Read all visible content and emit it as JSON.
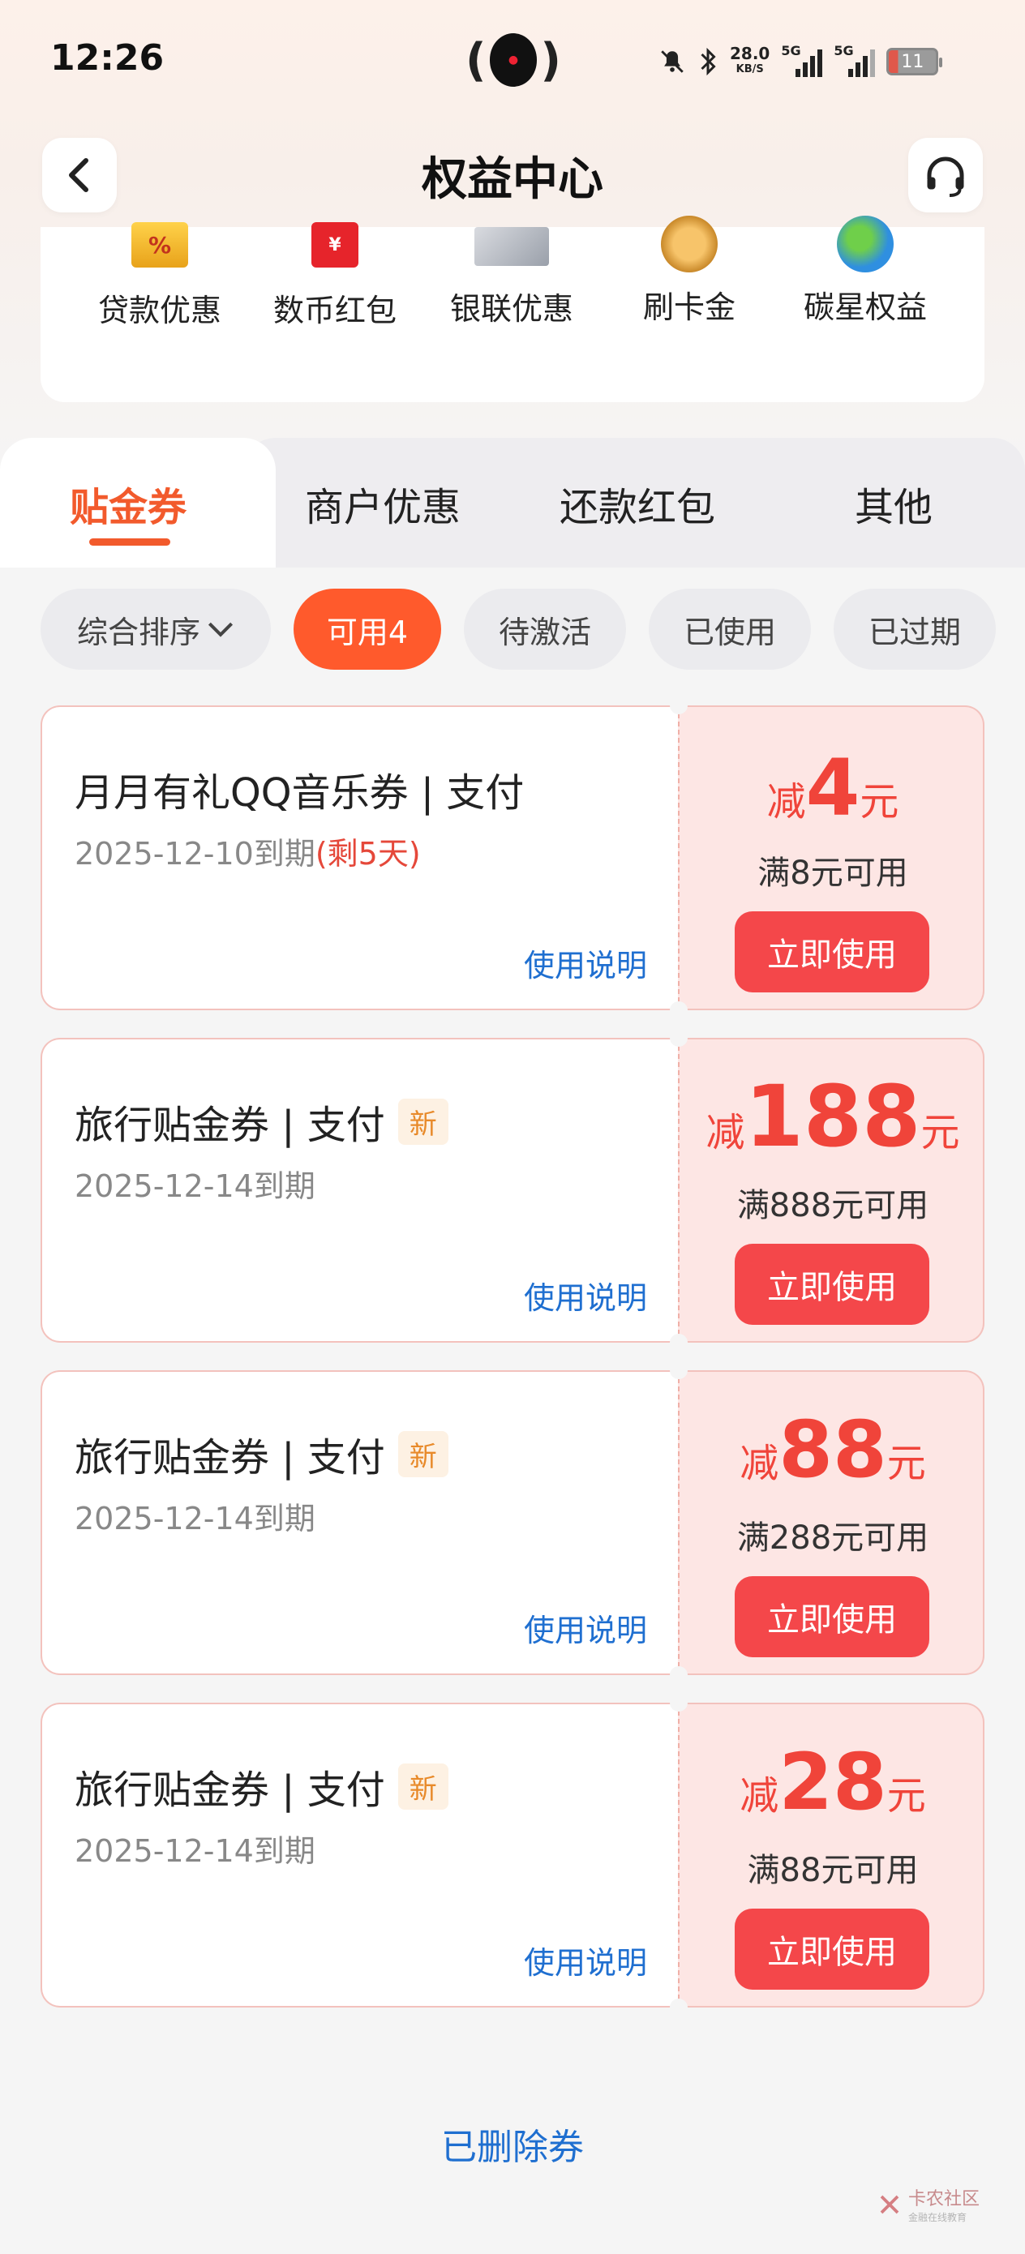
{
  "status_bar": {
    "time": "12:26",
    "speed_value": "28.0",
    "speed_unit": "KB/S",
    "signal1_label": "5G",
    "signal2_label": "5G",
    "battery": "11"
  },
  "header": {
    "title": "权益中心"
  },
  "quick_links": [
    {
      "label": "贷款优惠",
      "icon": "percent-icon"
    },
    {
      "label": "数币红包",
      "icon": "red-packet-icon"
    },
    {
      "label": "银联优惠",
      "icon": "unionpay-card-icon"
    },
    {
      "label": "刷卡金",
      "icon": "gold-coin-icon"
    },
    {
      "label": "碳星权益",
      "icon": "globe-icon"
    }
  ],
  "tabs": [
    {
      "label": "贴金券",
      "active": true
    },
    {
      "label": "商户优惠",
      "active": false
    },
    {
      "label": "还款红包",
      "active": false
    },
    {
      "label": "其他",
      "active": false
    }
  ],
  "filters": {
    "sort": "综合排序",
    "available": "可用4",
    "pending": "待激活",
    "used": "已使用",
    "expired": "已过期"
  },
  "coupons": [
    {
      "title": "月月有礼QQ音乐券 | 支付",
      "is_new": false,
      "new_label": "",
      "expiry": "2025-12-10到期",
      "remaining": "(剩5天)",
      "help": "使用说明",
      "prefix": "减",
      "amount": "4",
      "suffix": "元",
      "condition": "满8元可用",
      "button": "立即使用"
    },
    {
      "title": "旅行贴金券 | 支付",
      "is_new": true,
      "new_label": "新",
      "expiry": "2025-12-14到期",
      "remaining": "",
      "help": "使用说明",
      "prefix": "减",
      "amount": "188",
      "suffix": "元",
      "condition": "满888元可用",
      "button": "立即使用"
    },
    {
      "title": "旅行贴金券 | 支付",
      "is_new": true,
      "new_label": "新",
      "expiry": "2025-12-14到期",
      "remaining": "",
      "help": "使用说明",
      "prefix": "减",
      "amount": "88",
      "suffix": "元",
      "condition": "满288元可用",
      "button": "立即使用"
    },
    {
      "title": "旅行贴金券 | 支付",
      "is_new": true,
      "new_label": "新",
      "expiry": "2025-12-14到期",
      "remaining": "",
      "help": "使用说明",
      "prefix": "减",
      "amount": "28",
      "suffix": "元",
      "condition": "满88元可用",
      "button": "立即使用"
    }
  ],
  "footer": {
    "deleted_link": "已删除券"
  },
  "watermark": {
    "name": "卡农社区",
    "sub": "金融在线教育"
  },
  "colors": {
    "accent": "#f25a2c",
    "coupon_red": "#f0443a",
    "button_red": "#f4474a",
    "link_blue": "#1f6fd0"
  }
}
